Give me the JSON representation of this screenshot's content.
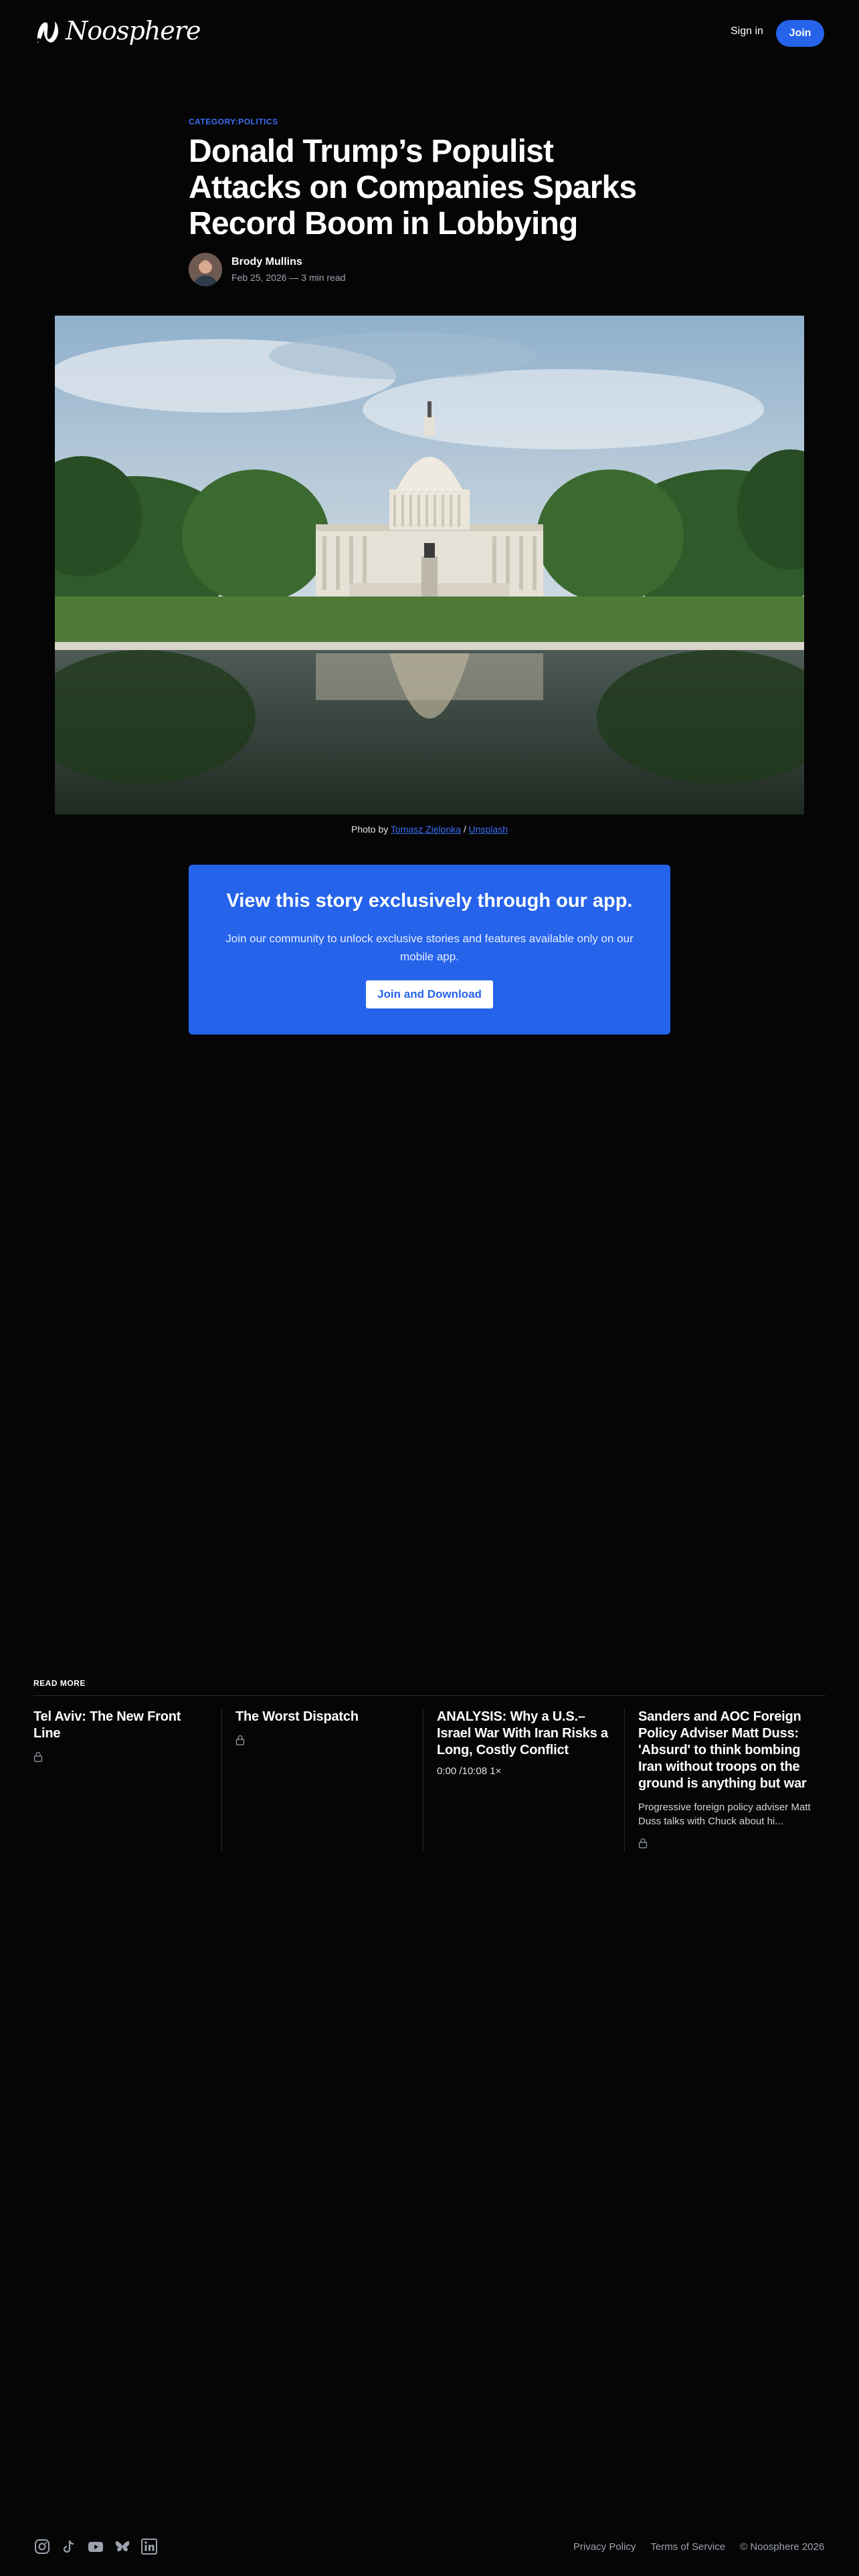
{
  "site": {
    "name": "Noosphere",
    "colors": {
      "accent": "#2563eb",
      "background": "#050505",
      "category": "#3b6ef5"
    }
  },
  "header": {
    "signin_label": "Sign in",
    "join_label": "Join"
  },
  "article": {
    "category": "CATEGORY:POLITICS",
    "title": "Donald Trump’s Populist Attacks on Companies Sparks Record Boom in Lobbying",
    "author": "Brody Mullins",
    "meta": "Feb 25, 2026 — 3 min read",
    "caption_prefix": "Photo by ",
    "caption_author": "Tomasz Zielonka",
    "caption_sep": " / ",
    "caption_source": "Unsplash"
  },
  "cta": {
    "heading": "View this story exclusively through our app.",
    "text": "Join our community to unlock exclusive stories and features available only on our mobile app.",
    "button": "Join and Download"
  },
  "read_more": {
    "label": "READ MORE",
    "items": [
      {
        "title": "Tel Aviv: The New Front Line",
        "icon": "lock-icon"
      },
      {
        "title": "The Worst Dispatch",
        "icon": "lock-icon"
      },
      {
        "title": "ANALYSIS: Why a U.S.– Israel War With Iran Risks a Long, Costly Conflict",
        "audio": "0:00 /10:08 1×"
      },
      {
        "title": "Sanders and AOC Foreign Policy Adviser Matt Duss: 'Absurd' to think bombing Iran without troops on the ground is anything but war",
        "excerpt": "Progressive foreign policy adviser Matt Duss talks with Chuck about hi...",
        "icon": "lock-icon"
      }
    ]
  },
  "footer": {
    "social": [
      "instagram-icon",
      "tiktok-icon",
      "youtube-icon",
      "bluesky-icon",
      "linkedin-icon"
    ],
    "privacy": "Privacy Policy",
    "terms": "Terms of Service",
    "copyright": "© Noosphere 2026"
  }
}
